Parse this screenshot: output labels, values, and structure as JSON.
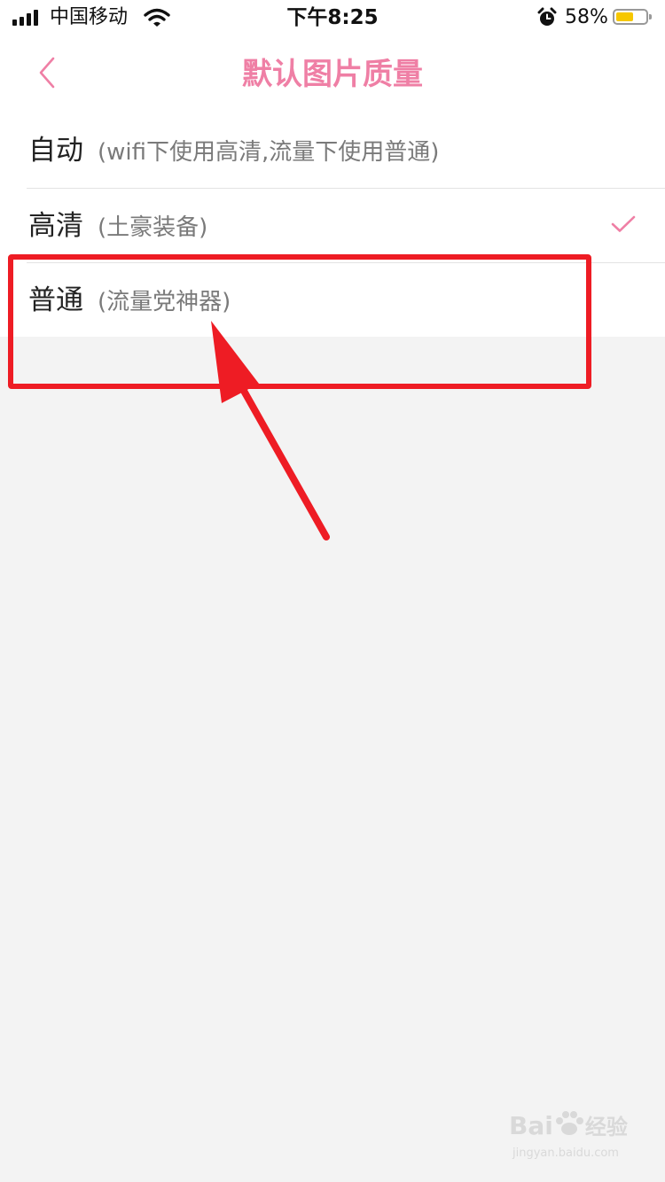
{
  "status_bar": {
    "carrier": "中国移动",
    "time": "下午8:25",
    "battery_percent": "58%",
    "battery_level": 0.58,
    "icons": [
      "signal-icon",
      "wifi-icon",
      "alarm-icon",
      "battery-icon"
    ]
  },
  "header": {
    "title": "默认图片质量",
    "back_icon": "chevron-left-icon"
  },
  "options": [
    {
      "label": "自动",
      "note": "(wifi下使用高清,流量下使用普通)",
      "selected": false
    },
    {
      "label": "高清",
      "note": "(土豪装备)",
      "selected": true
    },
    {
      "label": "普通",
      "note": "(流量党神器)",
      "selected": false
    }
  ],
  "watermark": {
    "brand": "Bai",
    "brand_suffix": "经验",
    "url": "jingyan.baidu.com"
  },
  "colors": {
    "accent": "#ef7fa5",
    "annotation": "#ee1c24",
    "background": "#f3f3f3"
  }
}
